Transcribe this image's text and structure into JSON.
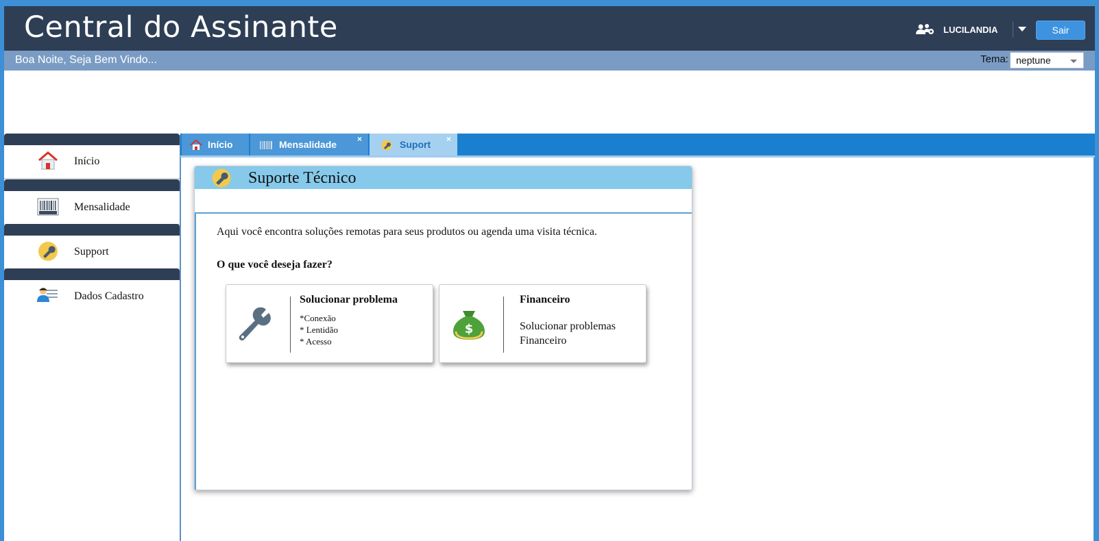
{
  "header": {
    "app_title": "Central do Assinante",
    "user_name": "LUCILANDIA",
    "logout_label": "Sair"
  },
  "subheader": {
    "greeting": "Boa Noite, Seja Bem Vindo...",
    "theme_label": "Tema:",
    "theme_value": "neptune"
  },
  "sidebar": {
    "items": [
      {
        "label": "Início",
        "icon": "home-icon"
      },
      {
        "label": "Mensalidade",
        "icon": "barcode-icon"
      },
      {
        "label": "Support",
        "icon": "wrench-icon"
      },
      {
        "label": "Dados Cadastro",
        "icon": "user-card-icon"
      }
    ]
  },
  "tabs": [
    {
      "label": "Início",
      "icon": "home-icon",
      "closable": false,
      "active": false
    },
    {
      "label": "Mensalidade",
      "icon": "barcode-icon",
      "closable": true,
      "close_glyph": "×",
      "active": false
    },
    {
      "label": "Suport",
      "icon": "wrench-icon",
      "closable": true,
      "close_glyph": "×",
      "active": true
    }
  ],
  "support_panel": {
    "title": "Suporte Técnico",
    "intro": "Aqui você encontra soluções remotas para seus produtos ou agenda uma visita técnica.",
    "question": "O que você deseja fazer?",
    "options": [
      {
        "title": "Solucionar problema",
        "lines": [
          "*Conexão",
          "* Lentidão",
          "* Acesso"
        ],
        "icon": "wrench-icon"
      },
      {
        "title": "Financeiro",
        "description_lines": [
          "Solucionar problemas",
          "Financeiro"
        ],
        "icon": "money-bag-icon"
      }
    ]
  },
  "colors": {
    "header_bg": "#2e3e55",
    "subheader_bg": "#7a9cc4",
    "tabstrip_bg": "#1b7fcf",
    "panel_header_bg": "#86c9ea",
    "accent": "#3d93e0"
  }
}
